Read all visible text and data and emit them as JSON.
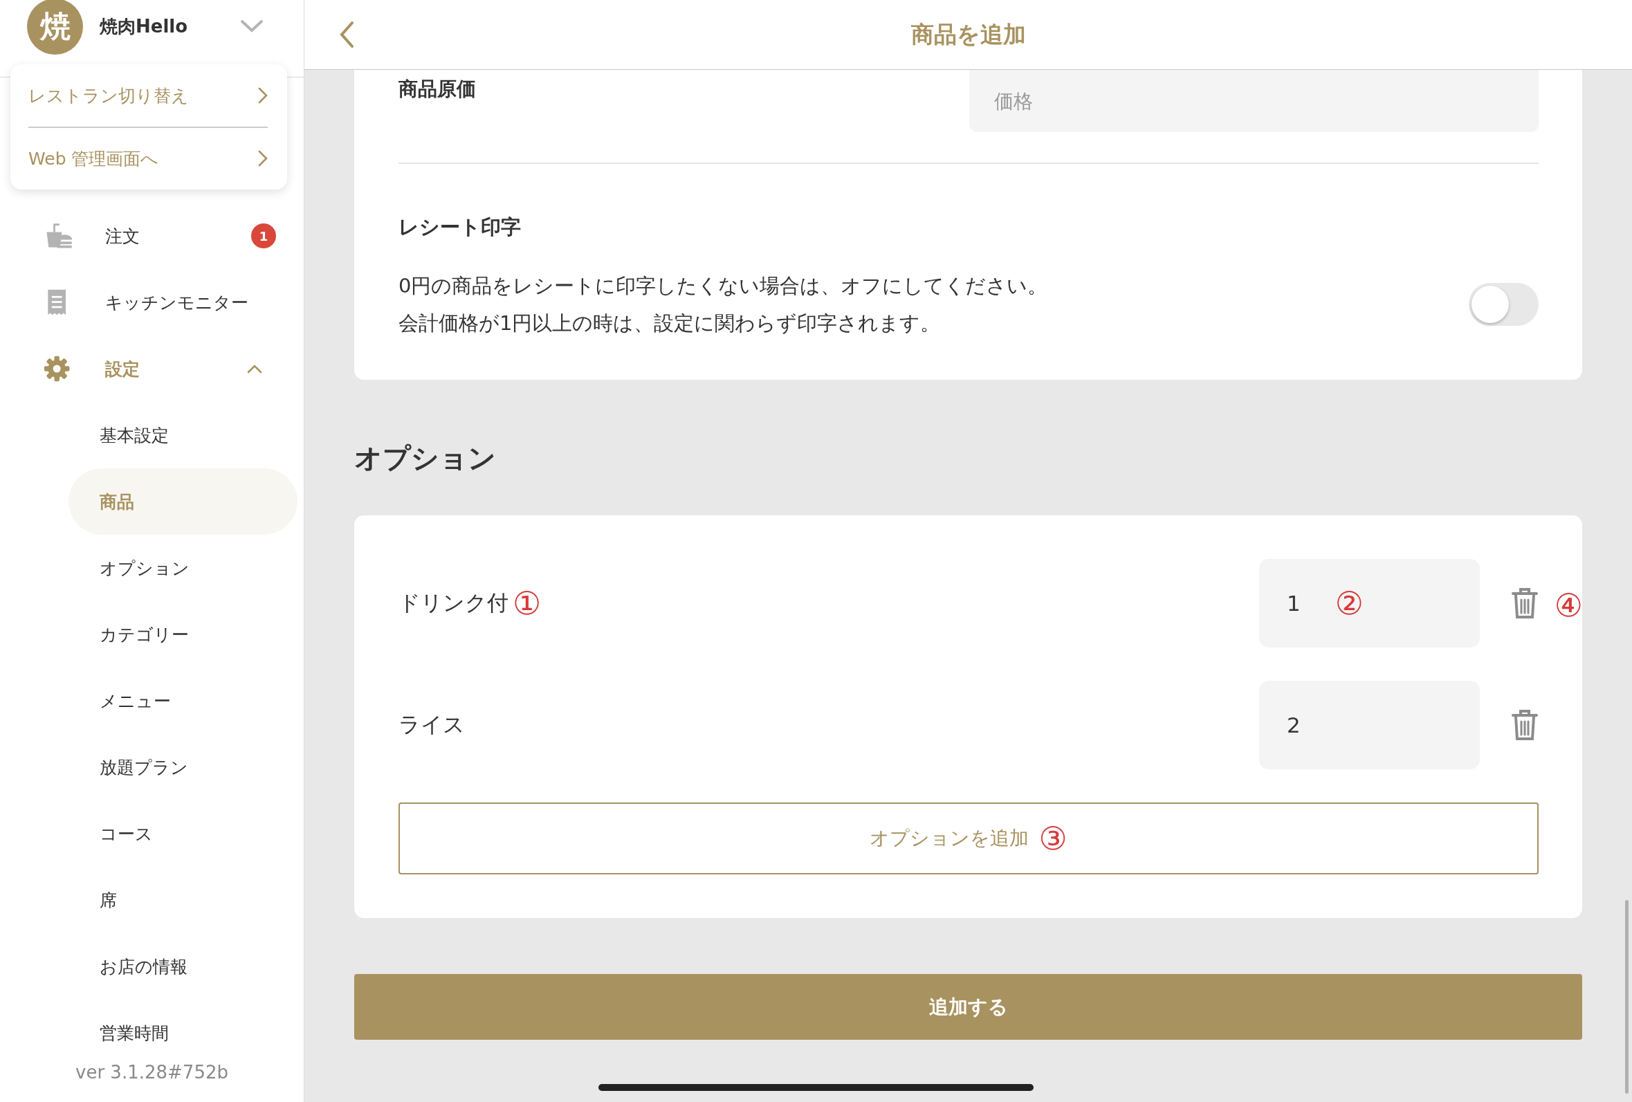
{
  "sidebar": {
    "avatar": "焼",
    "restaurant_name": "焼肉Hello",
    "menu_expanded": true,
    "popup_menu": [
      {
        "label": "レストラン切り替え"
      },
      {
        "label": "Web 管理画面へ"
      }
    ],
    "nav": [
      {
        "label": "注文",
        "badge": "1",
        "selected": false
      },
      {
        "label": "キッチンモニター",
        "selected": false
      },
      {
        "label": "設定",
        "selected": true,
        "expanded": true,
        "children": [
          {
            "label": "基本設定",
            "selected": false
          },
          {
            "label": "商品",
            "selected": true
          },
          {
            "label": "オプション",
            "selected": false
          },
          {
            "label": "カテゴリー",
            "selected": false
          },
          {
            "label": "メニュー",
            "selected": false
          },
          {
            "label": "放題プラン",
            "selected": false
          },
          {
            "label": "コース",
            "selected": false
          },
          {
            "label": "席",
            "selected": false
          },
          {
            "label": "お店の情報",
            "selected": false
          },
          {
            "label": "営業時間",
            "selected": false
          }
        ]
      }
    ],
    "version": "ver 3.1.28#752b"
  },
  "header": {
    "title": "商品を追加"
  },
  "cost_section": {
    "label": "商品原価",
    "placeholder": "価格"
  },
  "receipt_section": {
    "title": "レシート印字",
    "lines": [
      "0円の商品をレシートに印字したくない場合は、オフにしてください。",
      "会計価格が1円以上の時は、設定に関わらず印字されます。"
    ],
    "on": false
  },
  "options_heading": "オプション",
  "options": [
    {
      "name": "ドリンク付",
      "name_annotation": "①",
      "value": "1",
      "value_annotation": "②",
      "delete_annotation": "④"
    },
    {
      "name": "ライス",
      "value": "2"
    }
  ],
  "add_option_button": {
    "label": "オプションを追加",
    "annotation": "③"
  },
  "submit_button": "追加する"
}
